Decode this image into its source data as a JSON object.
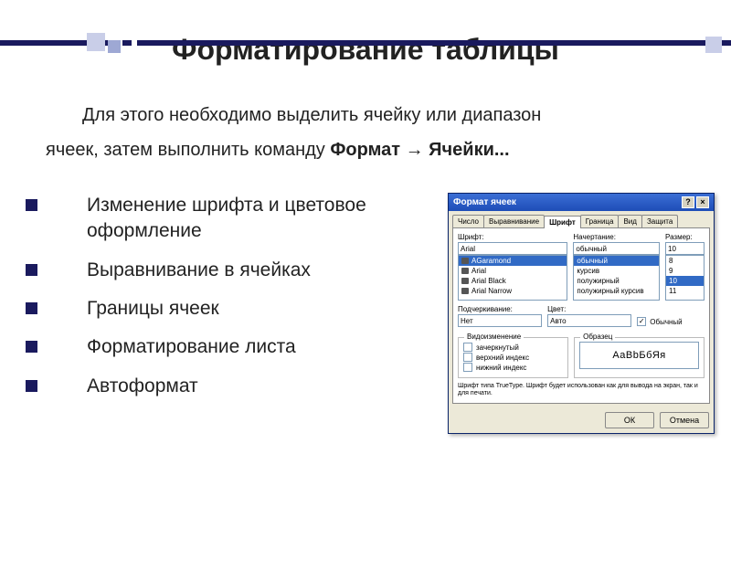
{
  "decor": {},
  "title": "Форматирование таблицы",
  "intro": {
    "line1": "Для этого необходимо выделить ячейку или диапазон",
    "line2_prefix": "ячеек, затем выполнить команду ",
    "cmd": "Формат → Ячейки..."
  },
  "bullets": [
    "Изменение шрифта и цветовое оформление",
    "Выравнивание в ячейках",
    "Границы ячеек",
    "Форматирование листа",
    "Автоформат"
  ],
  "dialog": {
    "title": "Формат ячеек",
    "help": "?",
    "close": "×",
    "tabs": [
      "Число",
      "Выравнивание",
      "Шрифт",
      "Граница",
      "Вид",
      "Защита"
    ],
    "active_tab": "Шрифт",
    "labels": {
      "font": "Шрифт:",
      "style": "Начертание:",
      "size": "Размер:",
      "underline": "Подчеркивание:",
      "color": "Цвет:",
      "normal_chk": "Обычный",
      "effects": "Видоизменение",
      "strike_chk": "зачеркнутый",
      "super_chk": "верхний индекс",
      "sub_chk": "нижний индекс",
      "sample": "Образец"
    },
    "font_value": "Arial",
    "font_list": [
      "AGaramond",
      "Arial",
      "Arial Black",
      "Arial Narrow"
    ],
    "style_value": "обычный",
    "style_list": [
      "обычный",
      "курсив",
      "полужирный",
      "полужирный курсив"
    ],
    "size_value": "10",
    "size_list": [
      "8",
      "9",
      "10",
      "11"
    ],
    "underline_value": "Нет",
    "color_value": "Авто",
    "sample_text": "АаВbБбЯя",
    "note": "Шрифт типа TrueType. Шрифт будет использован как для вывода на экран, так и для печати.",
    "ok": "ОК",
    "cancel": "Отмена"
  }
}
